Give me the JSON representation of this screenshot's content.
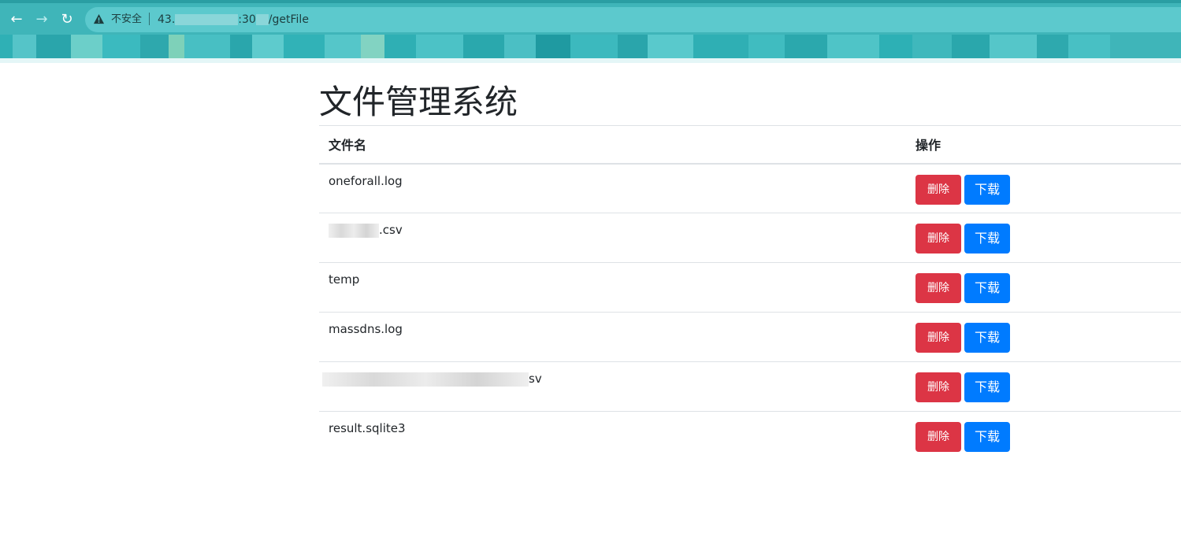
{
  "browser": {
    "insecure_label": "不安全",
    "url_visible": "43.",
    "url_port_fragment": ":30",
    "url_path": "/getFile"
  },
  "page": {
    "title": "文件管理系统",
    "columns": {
      "name": "文件名",
      "actions": "操作"
    },
    "delete_label": "删除",
    "download_label": "下载",
    "files": [
      {
        "name": "oneforall.log"
      },
      {
        "name": ".csv",
        "obscured": true
      },
      {
        "name": "temp"
      },
      {
        "name": "massdns.log"
      },
      {
        "name": "sv",
        "obscured": true
      },
      {
        "name": "result.sqlite3"
      }
    ]
  },
  "colors": {
    "chrome": "#3fb5b9",
    "danger": "#dc3545",
    "primary": "#007bff",
    "text": "#212529",
    "border": "#dee2e6"
  }
}
